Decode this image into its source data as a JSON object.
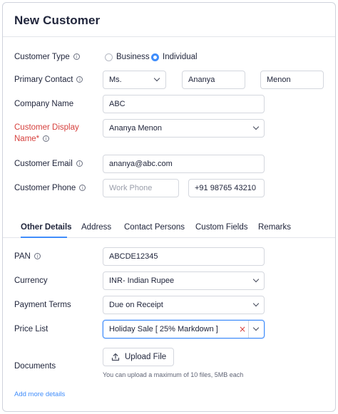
{
  "header": {
    "title": "New Customer"
  },
  "customer_type": {
    "label": "Customer Type",
    "info_icon": "i",
    "options": [
      {
        "label": "Business",
        "selected": false
      },
      {
        "label": "Individual",
        "selected": true
      }
    ]
  },
  "primary_contact": {
    "label": "Primary Contact",
    "info_icon": "i",
    "salutation": "Ms.",
    "first_name": "Ananya",
    "last_name": "Menon"
  },
  "company_name": {
    "label": "Company Name",
    "value": "ABC"
  },
  "display_name": {
    "label_line1": "Customer Display",
    "label_line2": "Name*",
    "info_icon": "i",
    "value": "Ananya Menon"
  },
  "email": {
    "label": "Customer Email",
    "info_icon": "i",
    "value": "ananya@abc.com"
  },
  "phone": {
    "label": "Customer Phone",
    "info_icon": "i",
    "work_placeholder": "Work Phone",
    "mobile": "+91 98765 43210"
  },
  "tabs": [
    {
      "label": "Other Details",
      "active": true
    },
    {
      "label": "Address",
      "active": false
    },
    {
      "label": "Contact Persons",
      "active": false
    },
    {
      "label": "Custom Fields",
      "active": false
    },
    {
      "label": "Remarks",
      "active": false
    }
  ],
  "pan": {
    "label": "PAN",
    "info_icon": "i",
    "value": "ABCDE12345"
  },
  "currency": {
    "label": "Currency",
    "value": "INR- Indian Rupee"
  },
  "payment_terms": {
    "label": "Payment Terms",
    "value": "Due on Receipt"
  },
  "price_list": {
    "label": "Price List",
    "value": "Holiday Sale [ 25% Markdown ]",
    "clear_icon": "×"
  },
  "documents": {
    "label": "Documents",
    "button": "Upload File",
    "hint": "You can upload a maximum of 10 files, 5MB each"
  },
  "add_more": "Add more details",
  "colors": {
    "accent": "#408dfb",
    "required": "#d6403d",
    "border": "#d4d7de"
  }
}
